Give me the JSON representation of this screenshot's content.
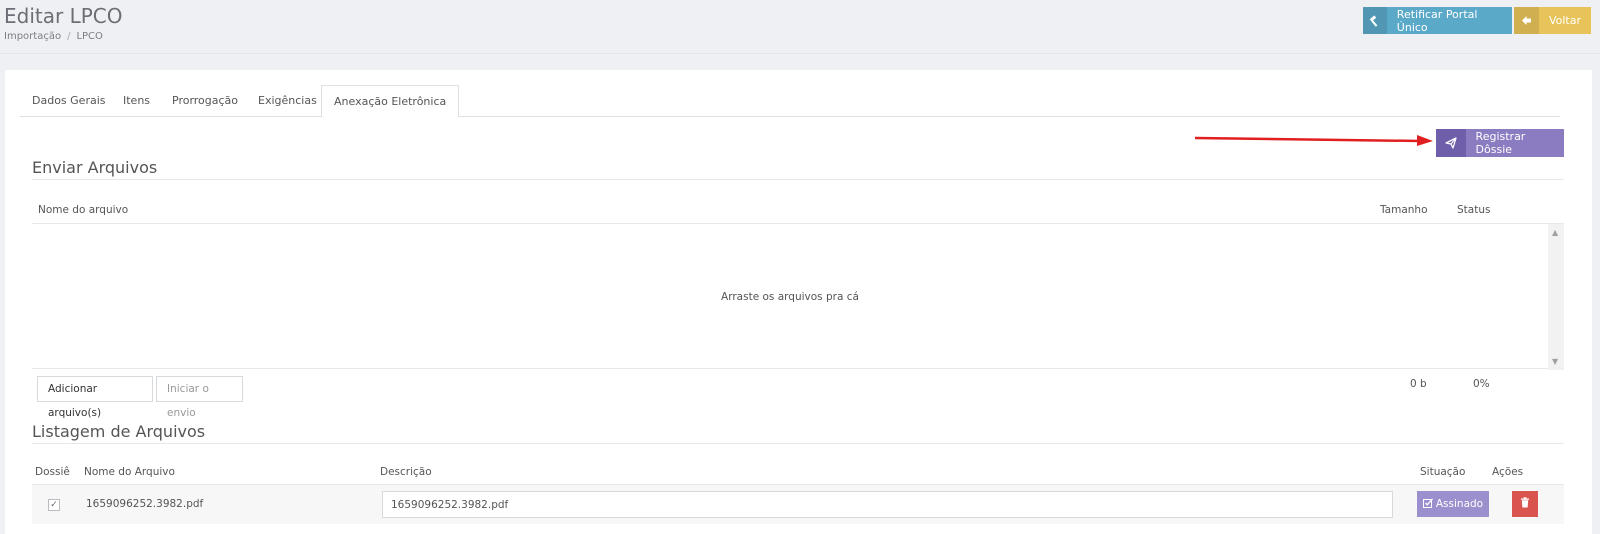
{
  "header": {
    "title": "Editar LPCO",
    "breadcrumb": [
      "Importação",
      "LPCO"
    ],
    "retificar_label": "Retificar Portal Único",
    "voltar_label": "Voltar"
  },
  "tabs": [
    {
      "label": "Dados Gerais"
    },
    {
      "label": "Itens"
    },
    {
      "label": "Prorrogação"
    },
    {
      "label": "Exigências"
    },
    {
      "label": "Anexação Eletrônica",
      "active": true
    }
  ],
  "registrar_label": "Registrar Dôssie",
  "enviar": {
    "title": "Enviar Arquivos",
    "columns": {
      "name": "Nome do arquivo",
      "size": "Tamanho",
      "status": "Status"
    },
    "dropzone_text": "Arraste os arquivos pra cá",
    "add_label": "Adicionar arquivo(s)",
    "start_label": "Iniciar o envio",
    "total_size": "0 b",
    "total_status": "0%"
  },
  "listagem": {
    "title": "Listagem de Arquivos",
    "columns": {
      "dossie": "Dossiê",
      "nome": "Nome do Arquivo",
      "descricao": "Descrição",
      "situacao": "Situação",
      "acoes": "Ações"
    },
    "rows": [
      {
        "nome": "1659096252.3982.pdf",
        "descricao": "1659096252.3982.pdf",
        "situacao": "Assinado",
        "checked": true
      }
    ]
  },
  "icons": {
    "retificar": "gavel-icon",
    "voltar": "arrow-left-icon",
    "registrar": "paper-plane-icon",
    "assinado": "edit-check-icon",
    "delete": "trash-icon"
  },
  "colors": {
    "retificar": "#5ba9c9",
    "voltar": "#e8c35a",
    "registrar": "#8b7bc0",
    "assinado": "#9b8fce",
    "delete": "#d9534f",
    "arrow": "#e02020"
  }
}
